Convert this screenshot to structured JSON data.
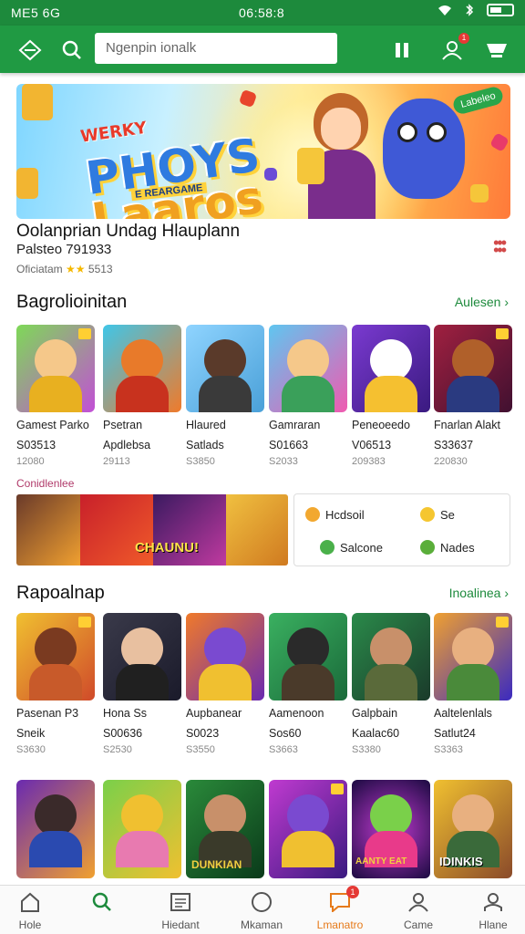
{
  "status_bar": {
    "left": "ME5 6G",
    "center": "06:58:8",
    "right_icons": [
      "wifi-icon",
      "bluetooth-icon",
      "battery-icon"
    ]
  },
  "app_bar": {
    "icons": [
      "home-diamond-icon",
      "search-icon",
      "pause-icon",
      "profile-icon",
      "cart-icon"
    ],
    "search_placeholder": "Ngenpin ionalk",
    "profile_badge": "1"
  },
  "hero": {
    "logo_line1": "WERKY",
    "logo_line2": "PHOYS",
    "logo_line3": "Laaros",
    "sub": "E REARGAME",
    "tag": "Labeleo"
  },
  "featured": {
    "title": "Oolanprian Undag Hlauplann",
    "subtitle": "Palsteo  791933",
    "meta_prefix": "Oficiatam",
    "stars": "★★",
    "meta_suffix": "5513"
  },
  "section1": {
    "title": "Bagrolioinitan",
    "link": "Aulesen",
    "tiles": [
      {
        "name": "Gamest Parko",
        "sub": "S03513",
        "price": "12080"
      },
      {
        "name": "Psetran",
        "sub": "Apdlebsa",
        "price": "29113"
      },
      {
        "name": "Hlaured",
        "sub": "Satlads",
        "price": "S3850"
      },
      {
        "name": "Gamraran",
        "sub": "S01663",
        "price": "S2033"
      },
      {
        "name": "Peneoeedo",
        "sub": "V06513",
        "price": "209383"
      },
      {
        "name": "Fnarlan Alakt",
        "sub": "S33637",
        "price": "220830"
      }
    ]
  },
  "mini_label": "Conidlenlee",
  "collage_text": "CHAUNU!",
  "categories": [
    {
      "label": "Hcdsoil"
    },
    {
      "label": "Se"
    },
    {
      "label": "Salcone"
    },
    {
      "label": "Nades"
    }
  ],
  "section2": {
    "title": "Rapoalnap",
    "link": "Inoalinea",
    "tiles": [
      {
        "name": "Pasenan P3",
        "sub": "Sneik",
        "price": "S3630"
      },
      {
        "name": "Hona Ss",
        "sub": "S00636",
        "price": "S2530"
      },
      {
        "name": "Aupbanear",
        "sub": "S0023",
        "price": "S3550"
      },
      {
        "name": "Aamenoon",
        "sub": "Sos60",
        "price": "S3663"
      },
      {
        "name": "Galpbain",
        "sub": "Kaalac60",
        "price": "S3380"
      },
      {
        "name": "Aaltelenlals",
        "sub": "Satlut24",
        "price": "S3363"
      }
    ]
  },
  "section3": {
    "tile_texts": [
      "",
      "",
      "DUNKIAN",
      "",
      "AANTY EAT",
      "IDINKIS"
    ]
  },
  "bottom_nav": [
    {
      "label": "Hole",
      "icon": "home-icon"
    },
    {
      "label": "",
      "icon": "search-icon"
    },
    {
      "label": "Hiedant",
      "icon": "list-icon"
    },
    {
      "label": "Mkaman",
      "icon": "circle-icon"
    },
    {
      "label": "Lmanatro",
      "icon": "chat-icon",
      "badge": "1",
      "active": true
    },
    {
      "label": "Came",
      "icon": "people-icon"
    },
    {
      "label": "Hlane",
      "icon": "person-icon"
    }
  ],
  "colors": {
    "brand_green": "#209a43",
    "active_orange": "#e67a1a",
    "badge_red": "#e53935"
  }
}
